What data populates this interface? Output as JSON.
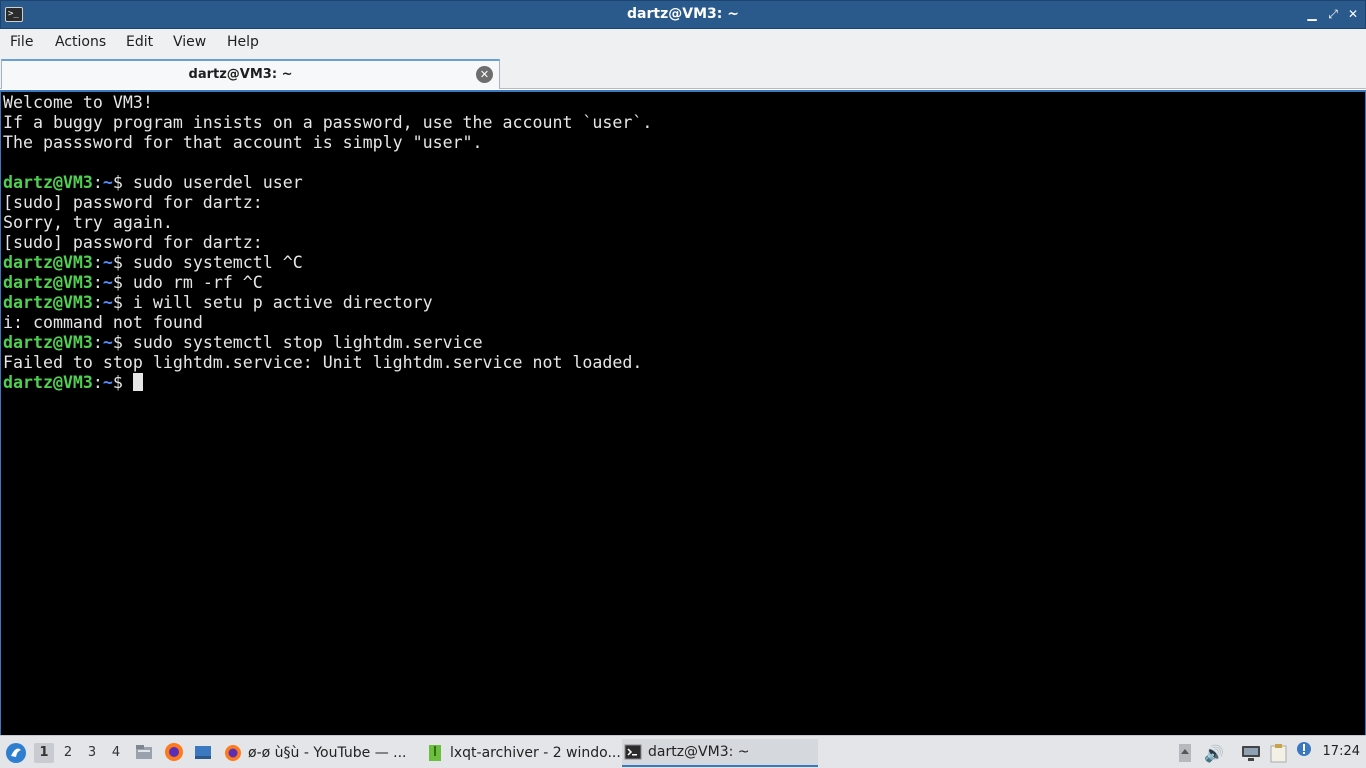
{
  "window": {
    "title": "dartz@VM3: ~",
    "app_icon_text": ">_"
  },
  "menu": {
    "items": [
      "File",
      "Actions",
      "Edit",
      "View",
      "Help"
    ]
  },
  "tab": {
    "label": "dartz@VM3: ~"
  },
  "prompt": {
    "user": "dartz@VM3",
    "sep": ":",
    "path": "~",
    "symbol": "$ "
  },
  "terminal": {
    "lines": [
      {
        "type": "out",
        "text": "Welcome to VM3!"
      },
      {
        "type": "out",
        "text": "If a buggy program insists on a password, use the account `user`."
      },
      {
        "type": "out",
        "text": "The passsword for that account is simply \"user\"."
      },
      {
        "type": "out",
        "text": ""
      },
      {
        "type": "cmd",
        "text": "sudo userdel user"
      },
      {
        "type": "out",
        "text": "[sudo] password for dartz:"
      },
      {
        "type": "out",
        "text": "Sorry, try again."
      },
      {
        "type": "out",
        "text": "[sudo] password for dartz:"
      },
      {
        "type": "cmd",
        "text": "sudo systemctl ^C"
      },
      {
        "type": "cmd",
        "text": "udo rm -rf ^C"
      },
      {
        "type": "cmd",
        "text": "i will setu p active directory"
      },
      {
        "type": "out",
        "text": "i: command not found"
      },
      {
        "type": "cmd",
        "text": "sudo systemctl stop lightdm.service"
      },
      {
        "type": "out",
        "text": "Failed to stop lightdm.service: Unit lightdm.service not loaded."
      },
      {
        "type": "cmd",
        "text": "",
        "cursor": true
      }
    ]
  },
  "taskbar": {
    "desktops": [
      "1",
      "2",
      "3",
      "4"
    ],
    "active_desktop": "1",
    "tasks": [
      {
        "label": "ø-ø ù§ù - YouTube — ...",
        "icon": "firefox-icon"
      },
      {
        "label": "lxqt-archiver - 2 windo...",
        "icon": "archiver-icon"
      },
      {
        "label": "dartz@VM3: ~",
        "icon": "terminal-icon",
        "active": true
      }
    ],
    "clock": "17:24"
  },
  "colors": {
    "titlebar": "#2a5a8c",
    "terminal_bg": "#000000",
    "prompt_user": "#50d050",
    "prompt_path": "#5090ff",
    "accent": "#3b78c0"
  }
}
